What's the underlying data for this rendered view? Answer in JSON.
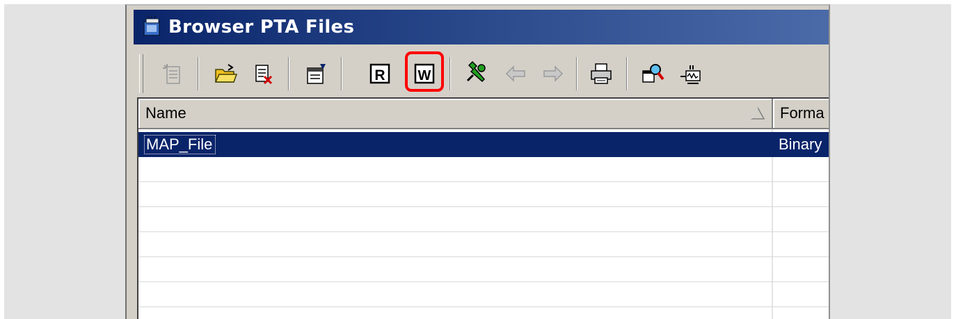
{
  "window": {
    "title": "Browser PTA Files"
  },
  "toolbar": {
    "buttons": [
      {
        "name": "new-file-icon",
        "enabled": false
      },
      {
        "name": "open-folder-icon",
        "enabled": true
      },
      {
        "name": "delete-file-icon",
        "enabled": true
      },
      {
        "name": "properties-icon",
        "enabled": true
      },
      {
        "name": "read-icon",
        "label": "R",
        "enabled": true
      },
      {
        "name": "write-icon",
        "label": "W",
        "enabled": true,
        "highlighted": true,
        "highlight_color": "#ff0000"
      },
      {
        "name": "tools-icon",
        "enabled": true
      },
      {
        "name": "back-arrow-icon",
        "enabled": false
      },
      {
        "name": "forward-arrow-icon",
        "enabled": false
      },
      {
        "name": "print-icon",
        "enabled": true
      },
      {
        "name": "search-icon",
        "enabled": true
      },
      {
        "name": "signal-icon",
        "enabled": true
      }
    ]
  },
  "list": {
    "columns": [
      "Name",
      "Forma"
    ],
    "rows": [
      {
        "name": "MAP_File",
        "format": "Binary",
        "selected": true
      }
    ]
  },
  "colors": {
    "titlebar": "#0a246a",
    "selection": "#0a246a",
    "highlight": "#ff0000"
  }
}
